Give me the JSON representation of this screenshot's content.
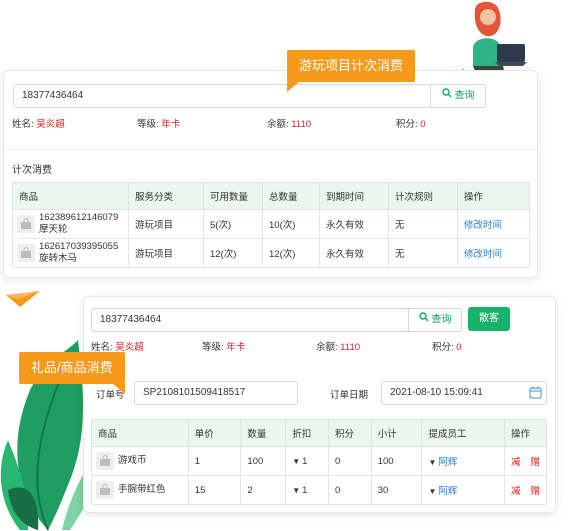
{
  "top": {
    "phone_value": "18377436464",
    "query_label": "查询",
    "info": {
      "name_label": "姓名:",
      "name_value": "吴炎超",
      "level_label": "等级:",
      "level_value": "年卡",
      "balance_label": "余额:",
      "balance_value": "1110",
      "points_label": "积分:",
      "points_value": "0"
    },
    "section_title": "计次消费",
    "columns": [
      "商品",
      "服务分类",
      "可用数量",
      "总数量",
      "到期时间",
      "计次规则",
      "操作"
    ],
    "rows": [
      {
        "code": "162389612146079",
        "name": "摩天轮",
        "category": "游玩项目",
        "available": "5(次)",
        "total": "10(次)",
        "expiry": "永久有效",
        "rule": "无",
        "action": "修改时间"
      },
      {
        "code": "162617039395055",
        "name": "旋转木马",
        "category": "游玩项目",
        "available": "12(次)",
        "total": "12(次)",
        "expiry": "永久有效",
        "rule": "无",
        "action": "修改时间"
      }
    ],
    "callout": "游玩项目计次消费"
  },
  "bottom": {
    "phone_value": "18377436464",
    "query_label": "查询",
    "settle_label": "散客",
    "info": {
      "name_label": "姓名:",
      "name_value": "吴炎超",
      "level_label": "等级:",
      "level_value": "年卡",
      "balance_label": "余额:",
      "balance_value": "1110",
      "points_label": "积分:",
      "points_value": "0"
    },
    "order_no_label": "订单号",
    "order_no_value": "SP2108101509418517",
    "order_date_label": "订单日期",
    "order_date_value": "2021-08-10 15:09:41",
    "columns": [
      "商品",
      "单价",
      "数量",
      "折扣",
      "积分",
      "小计",
      "提成员工",
      "操作"
    ],
    "rows": [
      {
        "name": "游戏币",
        "price": "1",
        "qty": "100",
        "discount": "1",
        "points": "0",
        "subtotal": "100",
        "staff": "阿辉",
        "act1": "减",
        "act2": "赠"
      },
      {
        "name": "手腕带红色",
        "price": "15",
        "qty": "2",
        "discount": "1",
        "points": "0",
        "subtotal": "30",
        "staff": "阿辉",
        "act1": "减",
        "act2": "赠"
      }
    ],
    "callout": "礼品/商品消费"
  },
  "colors": {
    "accent_green": "#19b26b",
    "callout_orange": "#f79a1c",
    "highlight_red": "#e02020",
    "link_blue": "#2a7fd4"
  }
}
